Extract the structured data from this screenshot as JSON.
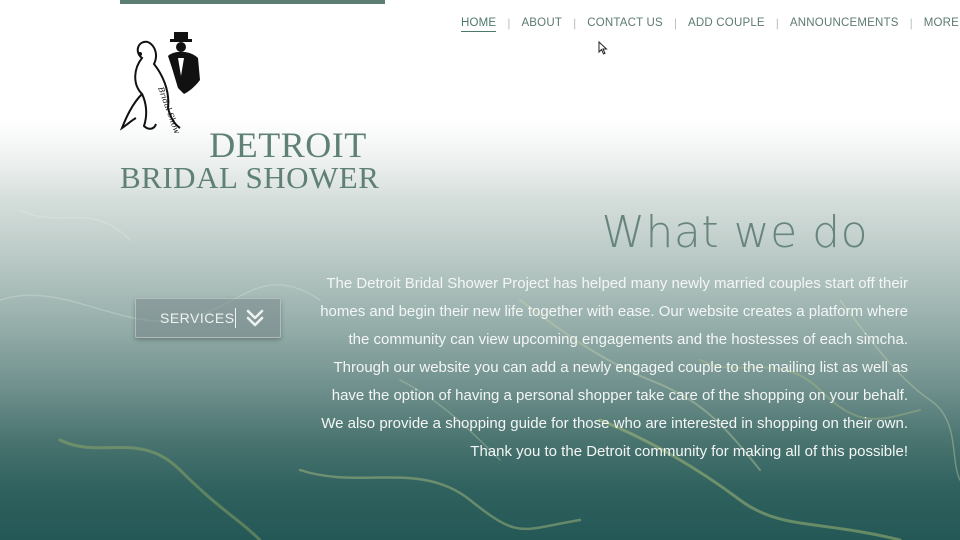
{
  "logo": {
    "line1": "DETROIT",
    "line2": "BRIDAL SHOWER",
    "art_text": "Bridal Shower"
  },
  "nav": {
    "items": [
      {
        "label": "HOME",
        "active": true
      },
      {
        "label": "ABOUT"
      },
      {
        "label": "CONTACT US"
      },
      {
        "label": "ADD COUPLE"
      },
      {
        "label": "ANNOUNCEMENTS"
      }
    ],
    "more": {
      "label": "MORE",
      "icon": "caret-down-icon"
    }
  },
  "services_button": {
    "label": "SERVICES",
    "icon": "double-chevron-down-icon"
  },
  "main": {
    "heading": "What we do",
    "lines": [
      "The Detroit Bridal Shower Project has helped many newly married couples start off their",
      "homes and begin their new life together with ease. Our website creates a platform where",
      "the community can view upcoming engagements and the hostesses of each simcha.",
      "Through our website you can add a newly engaged couple to the mailing list as well as",
      "have the option of having a personal shopper take care of the shopping on your behalf.",
      "We also provide a shopping guide for those who are interested in shopping on their own.",
      "Thank you to the Detroit community for making all of this possible!"
    ]
  },
  "colors": {
    "accent": "#5d7e73",
    "nav_text": "#5d7a70",
    "heading": "#67857d",
    "body_text": "#f3f6f5"
  }
}
